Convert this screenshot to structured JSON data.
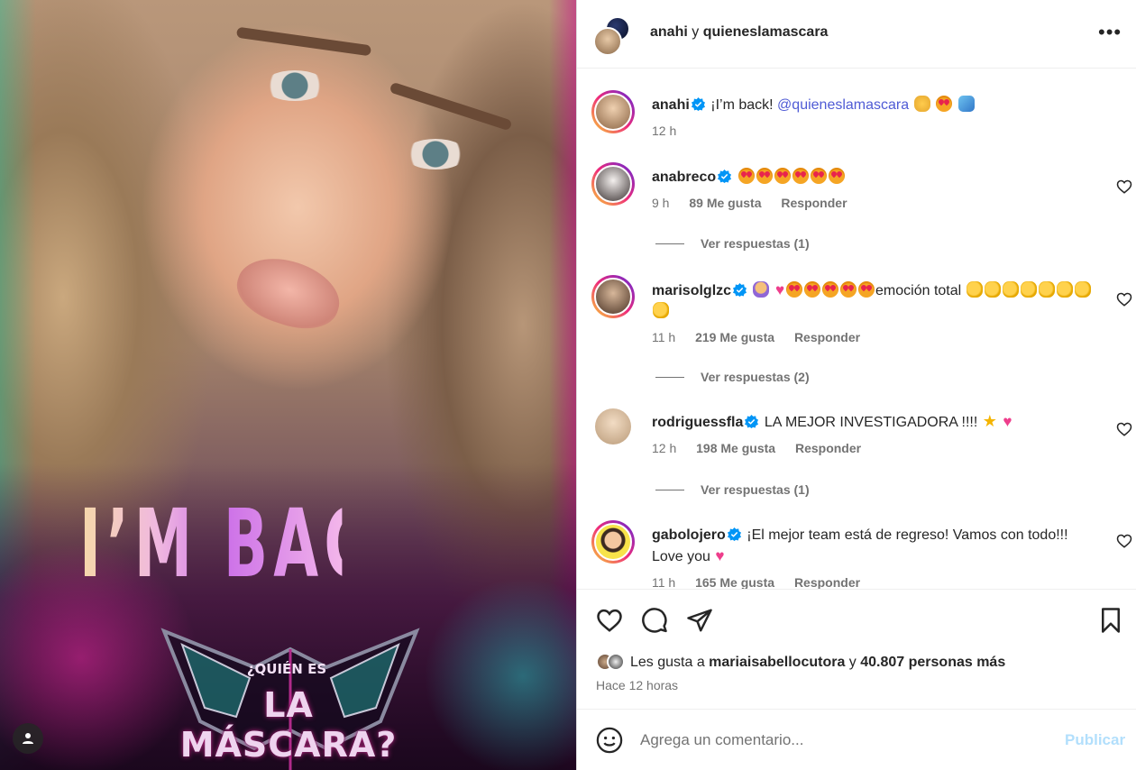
{
  "media": {
    "headline": "I’M BACK!",
    "logo_top": "¿QUIÉN ES",
    "logo_main": "LA MÁSCARA?"
  },
  "header": {
    "user1": "anahi",
    "connector": "y",
    "user2": "quieneslamascara",
    "more_label": "•••"
  },
  "caption": {
    "username": "anahi",
    "text": "¡I’m back! ",
    "mention": "@quieneslamascara",
    "time": "12 h"
  },
  "comments": [
    {
      "username": "anabreco",
      "text": "",
      "time": "9 h",
      "likes": "89 Me gusta",
      "reply": "Responder",
      "replies": "Ver respuestas (1)"
    },
    {
      "username": "marisolglzc",
      "text": "emoción total",
      "time": "11 h",
      "likes": "219 Me gusta",
      "reply": "Responder",
      "replies": "Ver respuestas (2)"
    },
    {
      "username": "rodriguessfla",
      "text": "LA MEJOR INVESTIGADORA !!!! ",
      "time": "12 h",
      "likes": "198 Me gusta",
      "reply": "Responder",
      "replies": "Ver respuestas (1)"
    },
    {
      "username": "gabolojero",
      "text": "¡El mejor team está de regreso! Vamos con todo!!! Love you ",
      "time": "11 h",
      "likes": "165 Me gusta",
      "reply": "Responder"
    }
  ],
  "likes": {
    "prefix": "Les gusta a ",
    "user": "mariaisabellocutora",
    "middle": " y ",
    "count": "40.807 personas más"
  },
  "date": "Hace 12 horas",
  "composer": {
    "placeholder": "Agrega un comentario...",
    "publish": "Publicar"
  },
  "colors": {
    "link": "#4f5bd5",
    "publish_disabled": "#b2dffc",
    "verified": "#0095f6"
  }
}
